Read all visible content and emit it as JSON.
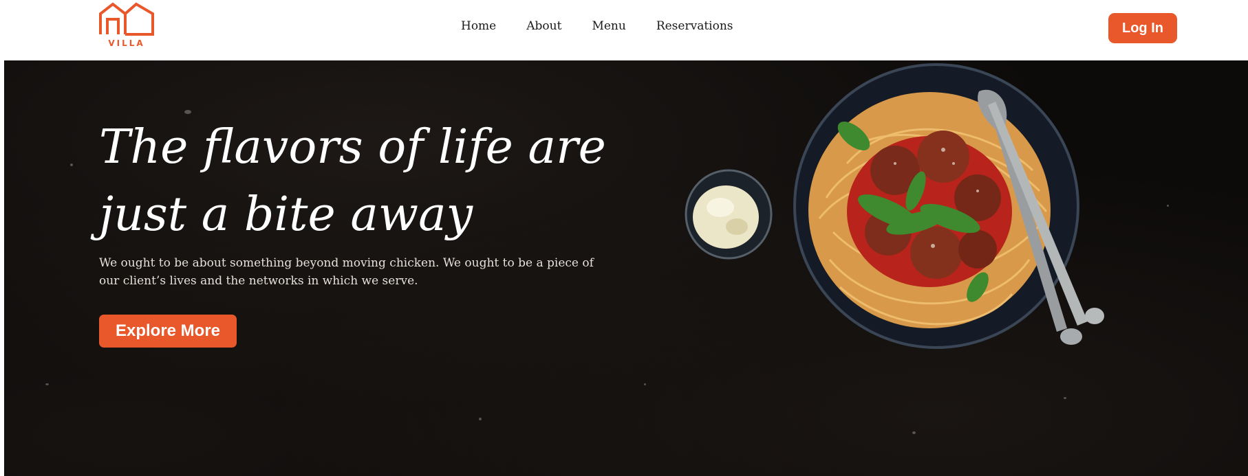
{
  "brand": {
    "name": "VILLA",
    "color": "#e8582b",
    "icon": "house-logo-icon"
  },
  "nav": {
    "items": [
      {
        "label": "Home"
      },
      {
        "label": "About"
      },
      {
        "label": "Menu"
      },
      {
        "label": "Reservations"
      }
    ]
  },
  "header": {
    "login_label": "Log In"
  },
  "hero": {
    "title_line1": "The flavors of life are",
    "title_line2": "just a bite away",
    "description": "We ought to be about something beyond moving chicken. We ought to be a piece of our client’s lives and the networks in which we serve.",
    "cta_label": "Explore More",
    "image": "spaghetti-meatballs-bowl-image"
  },
  "colors": {
    "accent": "#e8582b",
    "hero_bg": "#0d0b0a",
    "header_bg": "#ffffff"
  }
}
